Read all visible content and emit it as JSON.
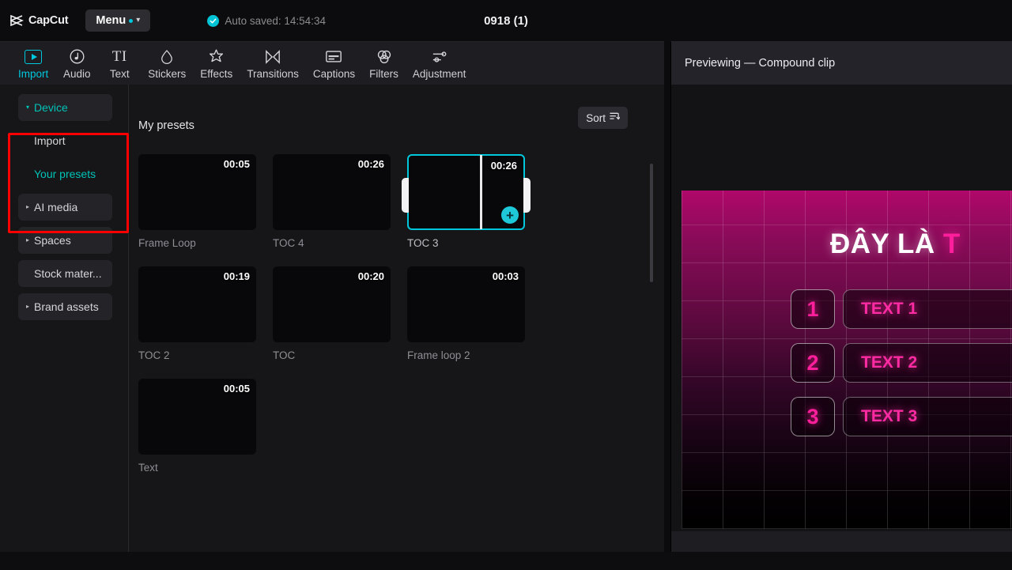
{
  "titlebar": {
    "brand": "CapCut",
    "brand_icon": "capcut-logo-icon",
    "menu_label": "Menu",
    "menu_dot_icon": "notification-dot-icon",
    "menu_chevron_icon": "chevron-down-icon",
    "autosave_icon": "check-circle-icon",
    "autosave_text": "Auto saved: 14:54:34",
    "project_title": "0918 (1)"
  },
  "toolbar": {
    "items": [
      {
        "label": "Import",
        "icon": "import-play-box-icon",
        "active": true
      },
      {
        "label": "Audio",
        "icon": "audio-note-icon",
        "active": false
      },
      {
        "label": "Text",
        "icon": "text-ti-icon",
        "active": false
      },
      {
        "label": "Stickers",
        "icon": "sticker-drop-icon",
        "active": false
      },
      {
        "label": "Effects",
        "icon": "effects-star-icon",
        "active": false
      },
      {
        "label": "Transitions",
        "icon": "transitions-bowtie-icon",
        "active": false
      },
      {
        "label": "Captions",
        "icon": "captions-box-icon",
        "active": false
      },
      {
        "label": "Filters",
        "icon": "filters-circles-icon",
        "active": false
      },
      {
        "label": "Adjustment",
        "icon": "adjustment-sliders-icon",
        "active": false
      }
    ]
  },
  "sidebar": {
    "items": [
      {
        "label": "Device",
        "style": "pill",
        "active": true,
        "caret": "▾"
      },
      {
        "label": "Import",
        "style": "plain",
        "active": false,
        "caret": ""
      },
      {
        "label": "Your presets",
        "style": "preset",
        "active": true,
        "caret": ""
      },
      {
        "label": "AI media",
        "style": "pill",
        "active": false,
        "caret": "▸"
      },
      {
        "label": "Spaces",
        "style": "pill",
        "active": false,
        "caret": "▸"
      },
      {
        "label": "Stock mater...",
        "style": "pill",
        "active": false,
        "caret": ""
      },
      {
        "label": "Brand assets",
        "style": "pill",
        "active": false,
        "caret": "▸"
      }
    ],
    "highlight_color": "#fe0000"
  },
  "content": {
    "section_title": "My presets",
    "sort_label": "Sort",
    "sort_icon": "sort-descending-icon",
    "cards": [
      {
        "name": "Frame Loop",
        "duration": "00:05",
        "selected": false
      },
      {
        "name": "TOC 4",
        "duration": "00:26",
        "selected": false
      },
      {
        "name": "TOC 3",
        "duration": "00:26",
        "selected": true
      },
      {
        "name": "TOC 2",
        "duration": "00:19",
        "selected": false
      },
      {
        "name": "TOC",
        "duration": "00:20",
        "selected": false
      },
      {
        "name": "Frame loop 2",
        "duration": "00:03",
        "selected": false
      },
      {
        "name": "Text",
        "duration": "00:05",
        "selected": false
      }
    ],
    "add_button_label": "+"
  },
  "preview": {
    "header": "Previewing — Compound clip",
    "video": {
      "headline_white": "ĐÂY LÀ ",
      "headline_pink": "T",
      "rows": [
        {
          "number": "1",
          "text": "TEXT 1"
        },
        {
          "number": "2",
          "text": "TEXT 2"
        },
        {
          "number": "3",
          "text": "TEXT 3"
        }
      ],
      "accent_color": "#ff2ba3",
      "background_color": "#b0086a"
    }
  }
}
